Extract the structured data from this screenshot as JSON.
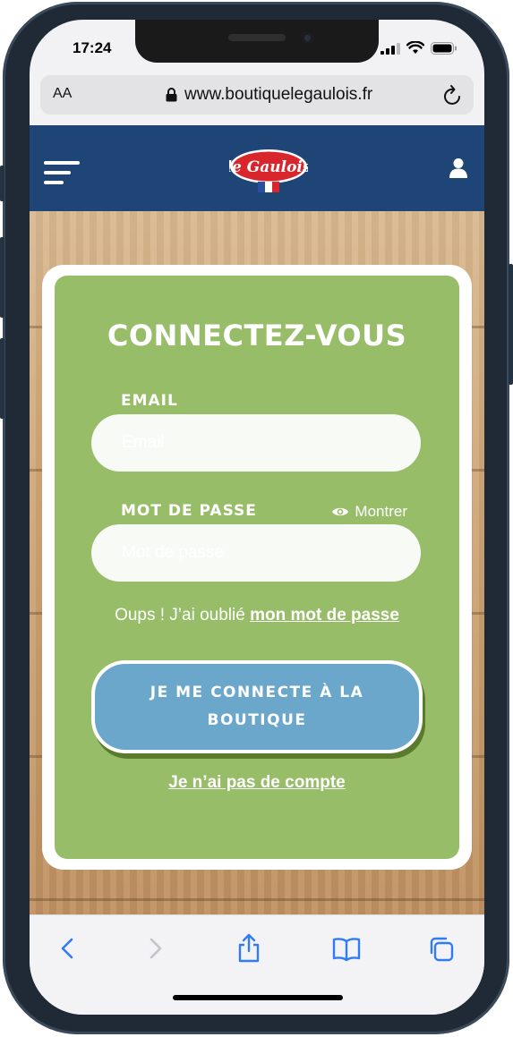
{
  "status": {
    "time": "17:24"
  },
  "browser": {
    "aa": "AA",
    "url": "www.boutiquelegaulois.fr"
  },
  "header": {
    "logo_text": "le Gaulois"
  },
  "login": {
    "title": "CONNECTEZ-VOUS",
    "email_label": "EMAIL",
    "email_placeholder": "Email",
    "password_label": "MOT DE PASSE",
    "password_placeholder": "Mot de passe",
    "show_label": "Montrer",
    "forgot_prefix": "Oups ! J’ai oublié",
    "forgot_link": "mon mot de passe",
    "submit_label": "JE ME CONNECTE À LA BOUTIQUE",
    "no_account": "Je n’ai pas de compte"
  },
  "colors": {
    "header_blue": "#1f4476",
    "card_green": "#97bd69",
    "button_blue": "#6aa7cb",
    "safari_blue": "#2f7cf6",
    "logo_red": "#d8262c"
  },
  "icons": [
    "lock-icon",
    "reload-icon",
    "hamburger-icon",
    "user-icon",
    "eye-icon",
    "back-icon",
    "forward-icon",
    "share-icon",
    "bookmarks-icon",
    "tabs-icon"
  ]
}
